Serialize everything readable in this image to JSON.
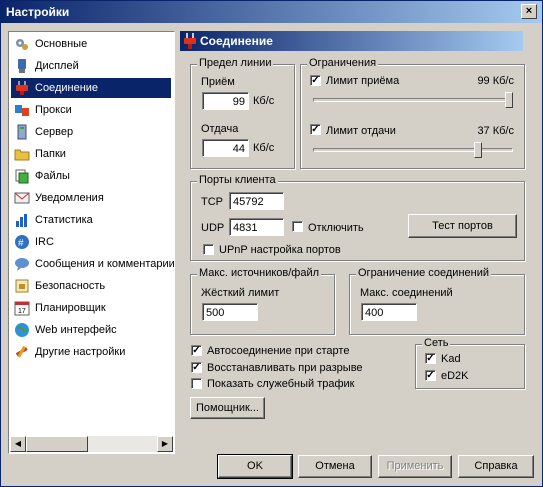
{
  "window": {
    "title": "Настройки",
    "close_glyph": "×"
  },
  "sidebar": {
    "items": [
      {
        "label": "Основные",
        "icon": "gears-icon"
      },
      {
        "label": "Дисплей",
        "icon": "monitor-icon"
      },
      {
        "label": "Соединение",
        "icon": "plug-icon"
      },
      {
        "label": "Прокси",
        "icon": "proxy-icon"
      },
      {
        "label": "Сервер",
        "icon": "server-icon"
      },
      {
        "label": "Папки",
        "icon": "folder-icon"
      },
      {
        "label": "Файлы",
        "icon": "files-icon"
      },
      {
        "label": "Уведомления",
        "icon": "notify-icon"
      },
      {
        "label": "Статистика",
        "icon": "stats-icon"
      },
      {
        "label": "IRC",
        "icon": "irc-icon"
      },
      {
        "label": "Сообщения и комментарии",
        "icon": "messages-icon"
      },
      {
        "label": "Безопасность",
        "icon": "security-icon"
      },
      {
        "label": "Планировщик",
        "icon": "calendar-icon"
      },
      {
        "label": "Web интерфейс",
        "icon": "globe-icon"
      },
      {
        "label": "Другие настройки",
        "icon": "tools-icon"
      }
    ],
    "selected_index": 2
  },
  "header": {
    "title": "Соединение"
  },
  "line_limit": {
    "title": "Предел линии",
    "download_label": "Приём",
    "download_value": "99",
    "download_unit": "Кб/с",
    "upload_label": "Отдача",
    "upload_value": "44",
    "upload_unit": "Кб/с"
  },
  "limits": {
    "title": "Ограничения",
    "download_limit_label": "Лимит приёма",
    "download_limit_value": "99 Кб/с",
    "download_checked": true,
    "download_slider_fraction": 1.0,
    "upload_limit_label": "Лимит отдачи",
    "upload_limit_value": "37 Кб/с",
    "upload_checked": true,
    "upload_slider_fraction": 0.84
  },
  "ports": {
    "title": "Порты клиента",
    "tcp_label": "TCP",
    "tcp_value": "45792",
    "udp_label": "UDP",
    "udp_value": "4831",
    "disable_label": "Отключить",
    "disable_checked": false,
    "test_button": "Тест портов",
    "upnp_label": "UPnP настройка портов",
    "upnp_checked": false
  },
  "max_sources": {
    "title": "Макс. источников/файл",
    "hard_limit_label": "Жёсткий лимит",
    "hard_limit_value": "500"
  },
  "conn_limit": {
    "title": "Ограничение соединений",
    "max_conn_label": "Макс. соединений",
    "max_conn_value": "400"
  },
  "options": {
    "autoconnect_label": "Автосоединение при старте",
    "autoconnect_checked": true,
    "reconnect_label": "Восстанавливать при разрыве",
    "reconnect_checked": true,
    "overhead_label": "Показать служебный трафик",
    "overhead_checked": false
  },
  "network": {
    "title": "Сеть",
    "kad_label": "Kad",
    "kad_checked": true,
    "ed2k_label": "eD2K",
    "ed2k_checked": true
  },
  "wizard_button": "Помощник...",
  "footer": {
    "ok": "OK",
    "cancel": "Отмена",
    "apply": "Применить",
    "help": "Справка"
  },
  "colors": {
    "titlebar_start": "#0a246a",
    "titlebar_end": "#a6caf0",
    "face": "#d4d0c8",
    "selection": "#0a246a"
  }
}
